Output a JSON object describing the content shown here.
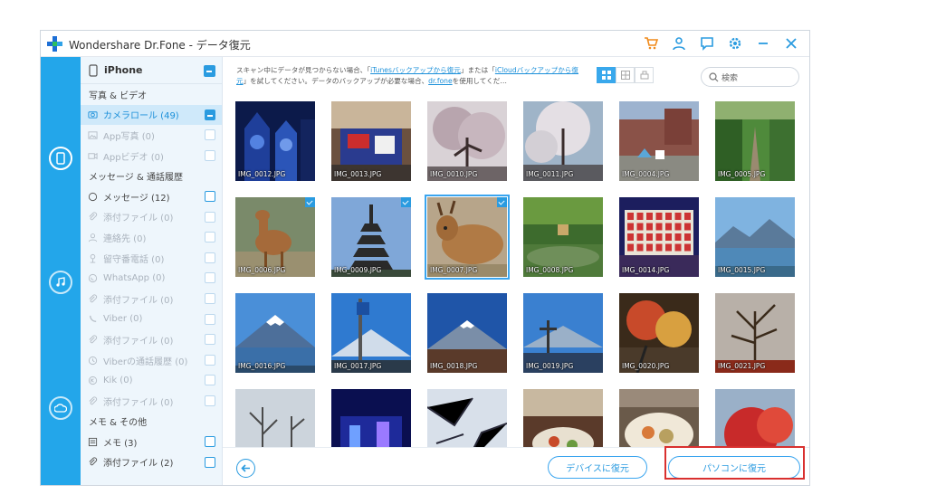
{
  "window": {
    "title": "Wondershare Dr.Fone - データ復元"
  },
  "colors": {
    "accent": "#23a6ea",
    "highlight": "#d9302f"
  },
  "titlebar_icons": [
    "cart-icon",
    "user-icon",
    "feedback-icon",
    "settings-icon",
    "minimize-icon",
    "close-icon"
  ],
  "device": {
    "name": "iPhone"
  },
  "categories": [
    {
      "type": "section",
      "label": "写真 & ビデオ"
    },
    {
      "type": "item",
      "label": "カメラロール (49)",
      "icon": "camera-icon",
      "state": "selected",
      "check": "on"
    },
    {
      "type": "item",
      "label": "App写真 (0)",
      "icon": "image-icon",
      "state": "disabled",
      "check": "off"
    },
    {
      "type": "item",
      "label": "Appビデオ (0)",
      "icon": "video-icon",
      "state": "disabled",
      "check": "off"
    },
    {
      "type": "section",
      "label": "メッセージ & 通話履歴"
    },
    {
      "type": "item",
      "label": "メッセージ (12)",
      "icon": "message-icon",
      "state": "enabled",
      "check": "empty"
    },
    {
      "type": "item",
      "label": "添付ファイル (0)",
      "icon": "attachment-icon",
      "state": "disabled",
      "check": "off"
    },
    {
      "type": "item",
      "label": "連絡先 (0)",
      "icon": "contact-icon",
      "state": "disabled",
      "check": "off"
    },
    {
      "type": "item",
      "label": "留守番電話 (0)",
      "icon": "voicemail-icon",
      "state": "disabled",
      "check": "off"
    },
    {
      "type": "item",
      "label": "WhatsApp (0)",
      "icon": "whatsapp-icon",
      "state": "disabled",
      "check": "off"
    },
    {
      "type": "item",
      "label": "添付ファイル (0)",
      "icon": "attachment-icon",
      "state": "disabled",
      "check": "off"
    },
    {
      "type": "item",
      "label": "Viber (0)",
      "icon": "viber-icon",
      "state": "disabled",
      "check": "off"
    },
    {
      "type": "item",
      "label": "添付ファイル (0)",
      "icon": "attachment-icon",
      "state": "disabled",
      "check": "off"
    },
    {
      "type": "item",
      "label": "Viberの通話履歴 (0)",
      "icon": "clock-icon",
      "state": "disabled",
      "check": "off"
    },
    {
      "type": "item",
      "label": "Kik (0)",
      "icon": "kik-icon",
      "state": "disabled",
      "check": "off"
    },
    {
      "type": "item",
      "label": "添付ファイル (0)",
      "icon": "attachment-icon",
      "state": "disabled",
      "check": "off"
    },
    {
      "type": "section",
      "label": "メモ & その他"
    },
    {
      "type": "item",
      "label": "メモ (3)",
      "icon": "note-icon",
      "state": "enabled",
      "check": "empty"
    },
    {
      "type": "item",
      "label": "添付ファイル (2)",
      "icon": "attachment-icon",
      "state": "enabled",
      "check": "empty"
    }
  ],
  "notice": {
    "p1": "スキャン中にデータが見つからない場合、「",
    "l1": "iTunesバックアップから復元",
    "p2": "」または「",
    "l2": "iCloudバックアップから復元",
    "p3": "」を試してください。データのバックアップが必要な場合、",
    "l3": "dr.fone",
    "p4": "を使用してくだ…"
  },
  "search": {
    "placeholder": "検索"
  },
  "photos": [
    {
      "label": "IMG_0012.JPG",
      "scene": "church",
      "checked": false
    },
    {
      "label": "IMG_0013.JPG",
      "scene": "street",
      "checked": false
    },
    {
      "label": "IMG_0010.JPG",
      "scene": "blossom",
      "checked": false
    },
    {
      "label": "IMG_0011.JPG",
      "scene": "blossom2",
      "checked": false
    },
    {
      "label": "IMG_0004.JPG",
      "scene": "plaza",
      "checked": false
    },
    {
      "label": "IMG_0005.JPG",
      "scene": "path",
      "checked": false
    },
    {
      "label": "IMG_0006.JPG",
      "scene": "deer",
      "checked": true
    },
    {
      "label": "IMG_0009.JPG",
      "scene": "pagoda",
      "checked": true
    },
    {
      "label": "IMG_0007.JPG",
      "scene": "deer2",
      "checked": true,
      "highlight": true
    },
    {
      "label": "IMG_0008.JPG",
      "scene": "pond",
      "checked": false
    },
    {
      "label": "IMG_0014.JPG",
      "scene": "lanterns",
      "checked": false
    },
    {
      "label": "IMG_0015.JPG",
      "scene": "lake",
      "checked": false
    },
    {
      "label": "IMG_0016.JPG",
      "scene": "fuji",
      "checked": false
    },
    {
      "label": "IMG_0017.JPG",
      "scene": "sign",
      "checked": false
    },
    {
      "label": "IMG_0018.JPG",
      "scene": "fuji2",
      "checked": false
    },
    {
      "label": "IMG_0019.JPG",
      "scene": "cross",
      "checked": false
    },
    {
      "label": "IMG_0020.JPG",
      "scene": "garden",
      "checked": false
    },
    {
      "label": "IMG_0021.JPG",
      "scene": "trees",
      "checked": false
    },
    {
      "label": "",
      "scene": "bare",
      "checked": false
    },
    {
      "label": "",
      "scene": "night",
      "checked": false
    },
    {
      "label": "",
      "scene": "branches",
      "checked": false
    },
    {
      "label": "",
      "scene": "food",
      "checked": false
    },
    {
      "label": "",
      "scene": "food2",
      "checked": false
    },
    {
      "label": "",
      "scene": "red",
      "checked": false
    }
  ],
  "footer": {
    "device_restore": "デバイスに復元",
    "pc_restore": "パソコンに復元"
  }
}
